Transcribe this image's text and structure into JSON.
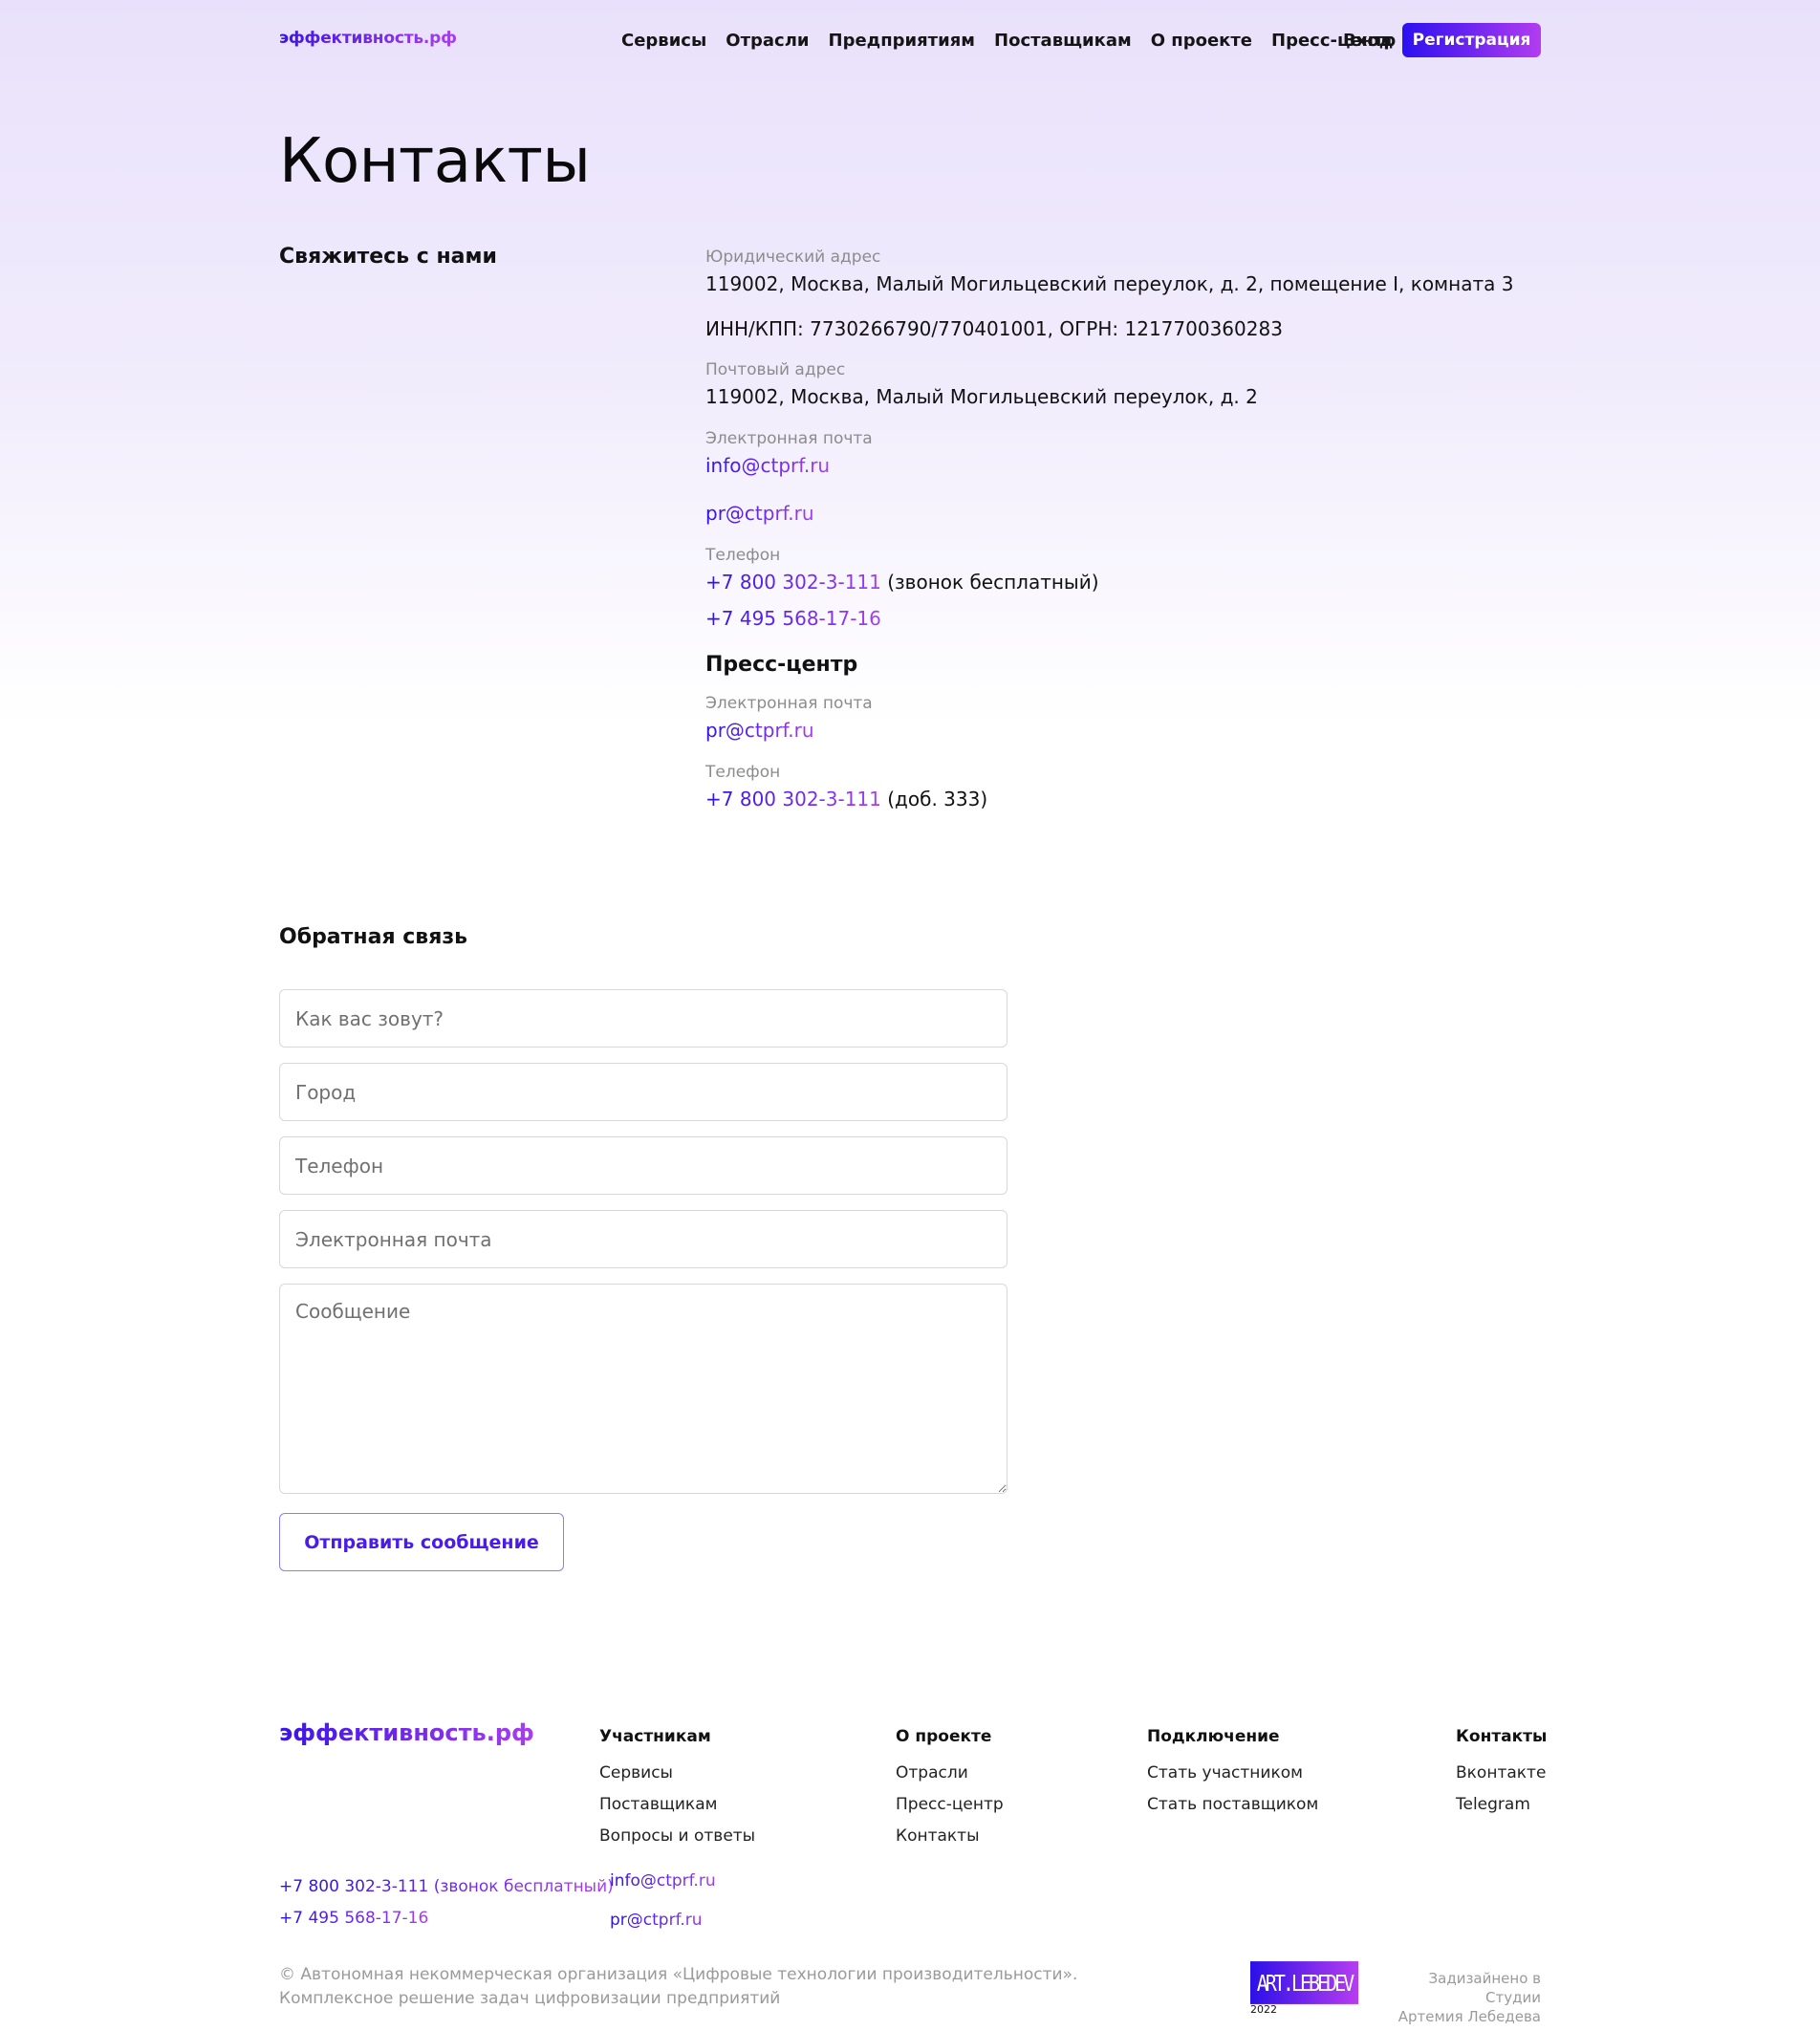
{
  "header": {
    "logo": "эффективность.рф",
    "nav": [
      "Сервисы",
      "Отрасли",
      "Предприятиям",
      "Поставщикам",
      "О проекте",
      "Пресс-центр"
    ],
    "login": "Вход",
    "register": "Регистрация"
  },
  "page_title": "Контакты",
  "contact": {
    "heading": "Свяжитесь с нами",
    "legal_label": "Юридический адрес",
    "legal_address": "119002, Москва, Малый Могильцевский переулок, д. 2, помещение I, комната 3",
    "requisites": "ИНН/КПП: 7730266790/770401001, ОГРН: 1217700360283",
    "postal_label": "Почтовый адрес",
    "postal_address": "119002, Москва, Малый Могильцевский переулок, д. 2",
    "email_label": "Электронная почта",
    "email1": "info@ctprf.ru",
    "email2": "pr@ctprf.ru",
    "phone_label": "Телефон",
    "phone1": "+7 800 302-3-111",
    "phone1_note": " (звонок бесплатный)",
    "phone2": "+7 495 568-17-16"
  },
  "press": {
    "heading": "Пресс-центр",
    "email_label": "Электронная почта",
    "email": "pr@ctprf.ru",
    "phone_label": "Телефон",
    "phone": "+7 800 302-3-111",
    "phone_note": " (доб. 333)"
  },
  "feedback": {
    "heading": "Обратная связь",
    "name_placeholder": "Как вас зовут?",
    "city_placeholder": "Город",
    "phone_placeholder": "Телефон",
    "email_placeholder": "Электронная почта",
    "message_placeholder": "Сообщение",
    "submit": "Отправить сообщение"
  },
  "footer": {
    "logo": "эффективность.рф",
    "columns": [
      {
        "title": "Участникам",
        "links": [
          "Сервисы",
          "Поставщикам",
          "Вопросы и ответы"
        ]
      },
      {
        "title": "О проекте",
        "links": [
          "Отрасли",
          "Пресс-центр",
          "Контакты"
        ]
      },
      {
        "title": "Подключение",
        "links": [
          "Стать участником",
          "Стать поставщиком"
        ]
      },
      {
        "title": "Контакты",
        "links": [
          "Вконтакте",
          "Telegram"
        ]
      }
    ],
    "phone1": "+7 800 302-3-111 (звонок бесплатный)",
    "phone2": "+7 495 568-17-16",
    "email1": "info@ctprf.ru",
    "email2": "pr@ctprf.ru",
    "copyright_line1": "© Автономная некоммерческая организация «Цифровые технологии производительности».",
    "copyright_line2": "Комплексное решение задач цифровизации предприятий",
    "studio_logo": "ART.LEBEDEV",
    "studio_year": "2022",
    "designed_line1": "Задизайнено в Студии",
    "designed_line2": "Артемия Лебедева"
  }
}
